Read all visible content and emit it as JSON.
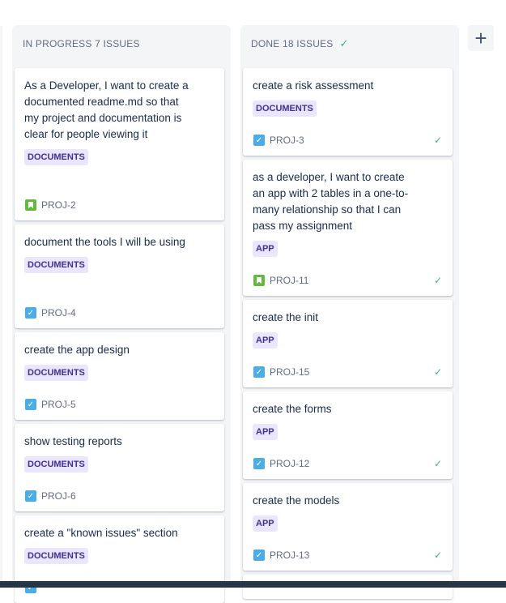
{
  "columns": [
    {
      "name": "IN PROGRESS 7 ISSUES",
      "cards": [
        {
          "title": "As a Developer, I want to create a documented readme.md so that my project and documentation is clear for people viewing it",
          "label": "DOCUMENTS",
          "key": "PROJ-2",
          "type": "story"
        },
        {
          "title": "document the tools I will be using",
          "label": "DOCUMENTS",
          "key": "PROJ-4",
          "type": "task"
        },
        {
          "title": "create the app design",
          "label": "DOCUMENTS",
          "key": "PROJ-5",
          "type": "task"
        },
        {
          "title": "show testing reports",
          "label": "DOCUMENTS",
          "key": "PROJ-6",
          "type": "task"
        },
        {
          "title": "create a \"known issues\" section",
          "label": "DOCUMENTS",
          "key": "",
          "type": "task"
        }
      ]
    },
    {
      "name": "DONE 18 ISSUES",
      "header_check": "✓",
      "cards": [
        {
          "title": "create a risk assessment",
          "label": "DOCUMENTS",
          "key": "PROJ-3",
          "type": "task",
          "done": "✓"
        },
        {
          "title": "as a developer, I want to create an app with 2 tables in a one-to-many relationship so that I can pass my assignment",
          "label": "APP",
          "key": "PROJ-11",
          "type": "story",
          "done": "✓"
        },
        {
          "title": "create the init",
          "label": "APP",
          "key": "PROJ-15",
          "type": "task",
          "done": "✓"
        },
        {
          "title": "create the forms",
          "label": "APP",
          "key": "PROJ-12",
          "type": "task",
          "done": "✓"
        },
        {
          "title": "create the models",
          "label": "APP",
          "key": "PROJ-13",
          "type": "task",
          "done": "✓"
        }
      ]
    }
  ],
  "add_column_icon": "plus-icon",
  "add_column_glyph": "+",
  "colors": {
    "column_bg": "#f4f5f7",
    "label_bg": "#eae6ff",
    "label_text": "#403294",
    "done_green": "#36b37e",
    "task_blue": "#4bade8",
    "story_green": "#63ba3c"
  }
}
